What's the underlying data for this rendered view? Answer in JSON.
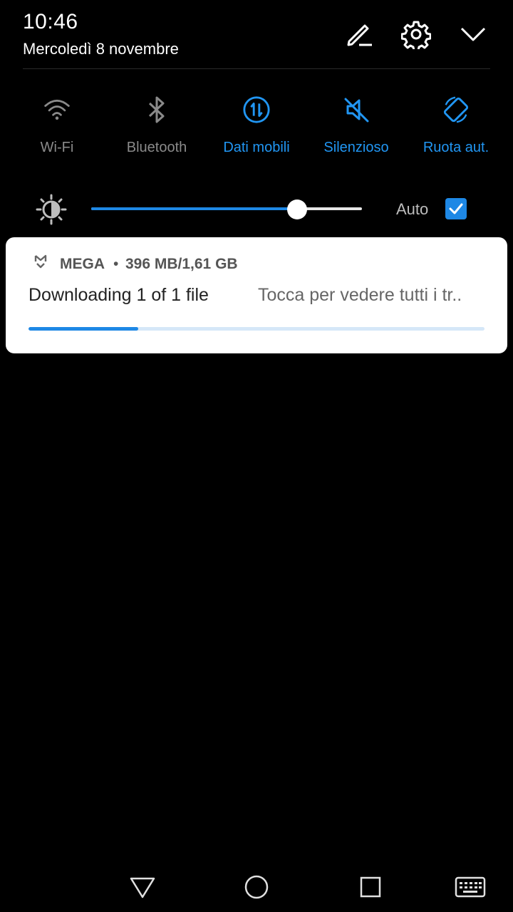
{
  "status": {
    "time": "10:46",
    "date": "Mercoledì 8 novembre"
  },
  "header_actions": [
    {
      "icon": "edit-icon"
    },
    {
      "icon": "gear-icon"
    },
    {
      "icon": "chevron-down-icon"
    }
  ],
  "quick_toggles": [
    {
      "label": "Wi-Fi",
      "icon": "wifi-icon",
      "active": false
    },
    {
      "label": "Bluetooth",
      "icon": "bluetooth-icon",
      "active": false
    },
    {
      "label": "Dati mobili",
      "icon": "mobile-data-icon",
      "active": true
    },
    {
      "label": "Silenzioso",
      "icon": "silent-icon",
      "active": true
    },
    {
      "label": "Ruota aut.",
      "icon": "auto-rotate-icon",
      "active": true
    }
  ],
  "brightness": {
    "level": 0.76,
    "auto_label": "Auto",
    "auto_checked": true
  },
  "notification": {
    "app_icon": "mega-icon",
    "app_name": "MEGA",
    "separator": "•",
    "size": "396 MB/1,61 GB",
    "title": "Downloading 1 of 1 file",
    "subtitle": "Tocca per vedere tutti i tr..",
    "progress": 0.24
  },
  "navigation": [
    {
      "icon": "back-icon"
    },
    {
      "icon": "home-icon"
    },
    {
      "icon": "recents-icon"
    },
    {
      "icon": "keyboard-icon"
    }
  ],
  "colors": {
    "accent": "#2196f3",
    "inactive": "#8a8a8a",
    "background": "#000000"
  }
}
